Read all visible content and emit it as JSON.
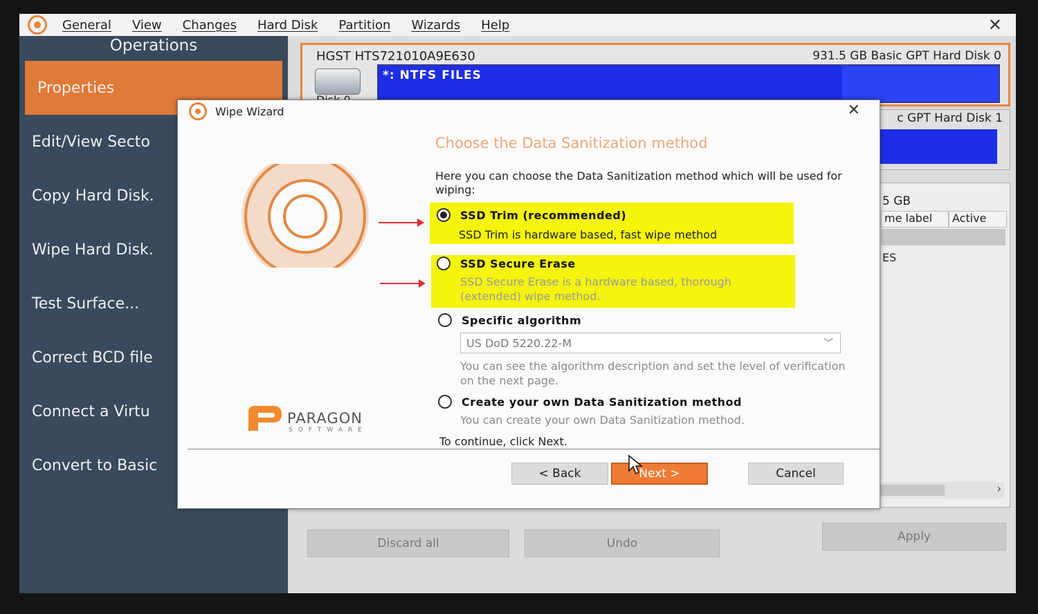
{
  "menu": [
    "General",
    "View",
    "Changes",
    "Hard Disk",
    "Partition",
    "Wizards",
    "Help"
  ],
  "sidebar": {
    "title": "Operations",
    "items": [
      {
        "label": "Properties",
        "active": true
      },
      {
        "label": "Edit/View Secto"
      },
      {
        "label": "Copy Hard Disk."
      },
      {
        "label": "Wipe Hard Disk."
      },
      {
        "label": "Test Surface..."
      },
      {
        "label": "Correct BCD file"
      },
      {
        "label": "Connect a Virtu"
      },
      {
        "label": "Convert to Basic"
      }
    ]
  },
  "disks": {
    "disk0": {
      "name": "HGST HTS721010A9E630",
      "info": "931.5 GB  Basic GPT Hard Disk 0",
      "label": "Disk 0",
      "partition": "*: NTFS FILES"
    },
    "disk1": {
      "info": "c GPT Hard Disk 1"
    }
  },
  "properties": {
    "size": "5 GB",
    "columns": [
      "me label",
      "Active"
    ],
    "row_fragment": "ES"
  },
  "bottom_buttons": {
    "discard": "Discard all",
    "undo": "Undo",
    "apply": "Apply"
  },
  "wizard": {
    "title": "Wipe Wizard",
    "heading": "Choose the Data Sanitization method",
    "description": "Here you can choose the Data Sanitization method which will be used for wiping:",
    "options": [
      {
        "label": "SSD Trim (recommended)",
        "desc": "SSD Trim is hardware based, fast wipe method",
        "checked": true
      },
      {
        "label": "SSD Secure Erase",
        "desc": "SSD Secure Erase is a hardware based, thorough (extended) wipe method."
      },
      {
        "label": "Specific algorithm",
        "desc": "You can see the algorithm description and set the level of verification on the next page."
      },
      {
        "label": "Create your own Data Sanitization method",
        "desc": "You can create your own Data Sanitization method."
      }
    ],
    "algorithm_select": "US DoD 5220.22-M",
    "continue_text": "To continue, click Next.",
    "buttons": {
      "back": "< Back",
      "next": "Next >",
      "cancel": "Cancel"
    },
    "brand": {
      "name": "PARAGON",
      "sub": "SOFTWARE"
    }
  },
  "colors": {
    "accent": "#e07a38",
    "highlight": "#f4f40c",
    "partition": "#1d2ee6",
    "sidebar": "#384a5c",
    "annotation": "#e03030"
  }
}
